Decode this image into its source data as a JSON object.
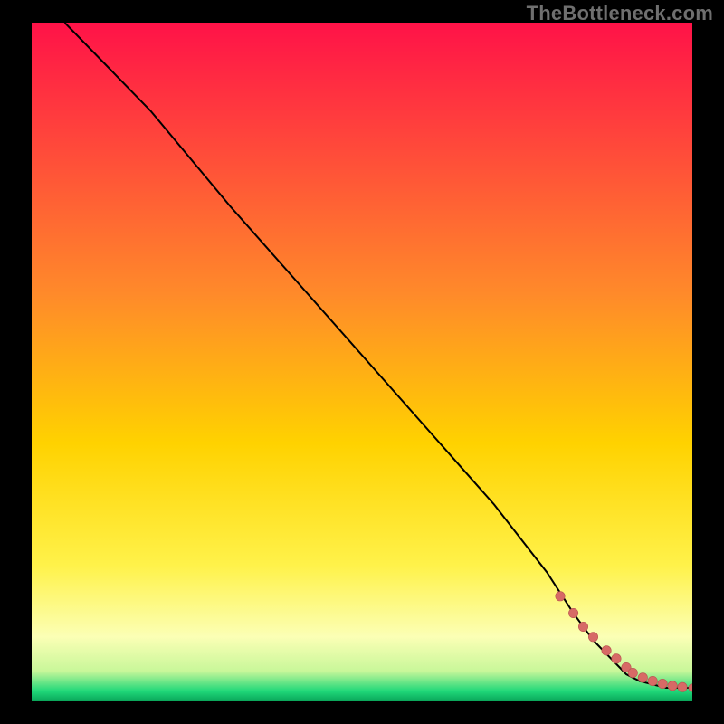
{
  "watermark": "TheBottleneck.com",
  "colors": {
    "bg_black": "#000000",
    "grad_top": "#ff1248",
    "grad_mid_upper": "#ff8a2a",
    "grad_mid": "#ffd200",
    "grad_mid_lower": "#fff24a",
    "grad_pale": "#fbffb5",
    "grad_green": "#1fd879",
    "curve": "#000000",
    "marker_fill": "#d76a66",
    "marker_stroke": "#b9534f"
  },
  "chart_data": {
    "type": "line",
    "title": "",
    "xlabel": "",
    "ylabel": "",
    "xlim": [
      0,
      100
    ],
    "ylim": [
      0,
      100
    ],
    "gradient_stops": [
      {
        "pos": 0.0,
        "color": "#ff1248"
      },
      {
        "pos": 0.4,
        "color": "#ff8a2a"
      },
      {
        "pos": 0.62,
        "color": "#ffd200"
      },
      {
        "pos": 0.8,
        "color": "#fff24a"
      },
      {
        "pos": 0.905,
        "color": "#fbffb5"
      },
      {
        "pos": 0.955,
        "color": "#c9f79a"
      },
      {
        "pos": 0.985,
        "color": "#1fd879"
      },
      {
        "pos": 1.0,
        "color": "#0aa559"
      }
    ],
    "series": [
      {
        "name": "curve",
        "x": [
          5,
          12,
          18,
          24,
          30,
          40,
          50,
          60,
          70,
          78,
          82,
          85,
          88,
          90,
          92,
          94,
          96,
          98,
          100
        ],
        "y": [
          100,
          93,
          87,
          80,
          73,
          62,
          51,
          40,
          29,
          19,
          13,
          9,
          6,
          4,
          3,
          2.5,
          2,
          2,
          2
        ]
      },
      {
        "name": "markers",
        "x": [
          80,
          82,
          83.5,
          85,
          87,
          88.5,
          90,
          91,
          92.5,
          94,
          95.5,
          97,
          98.5,
          100
        ],
        "y": [
          15.5,
          13,
          11,
          9.5,
          7.5,
          6.3,
          5,
          4.2,
          3.5,
          3,
          2.6,
          2.3,
          2.1,
          2
        ]
      }
    ]
  }
}
